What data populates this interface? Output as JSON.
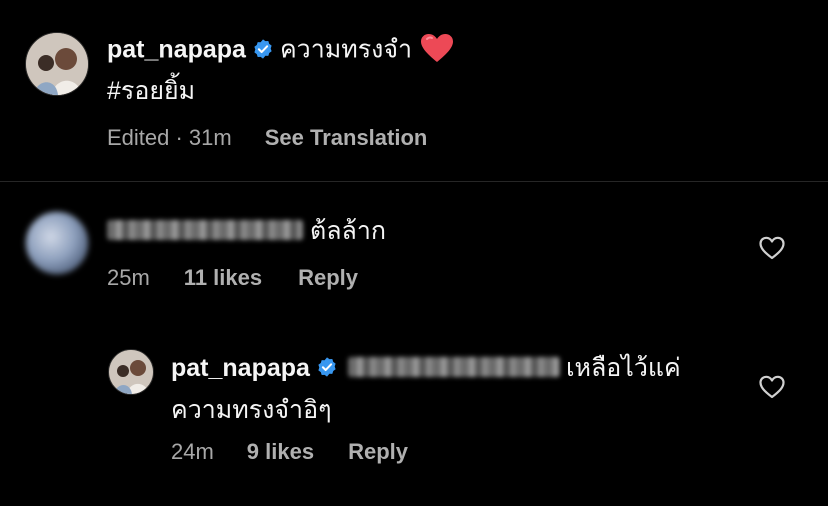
{
  "post": {
    "username": "pat_napapa",
    "caption_line1": "ความทรงจำ",
    "caption_line2": "#รอยยิ้ม",
    "edited": "Edited · 31m",
    "see_translation": "See Translation"
  },
  "comments": [
    {
      "text": "ต้ลล้าก",
      "time": "25m",
      "likes": "11 likes",
      "reply": "Reply"
    }
  ],
  "replies": [
    {
      "username": "pat_napapa",
      "text_line1": "เหลือไว้แค่",
      "text_line2": "ความทรงจำอิๆ",
      "time": "24m",
      "likes": "9 likes",
      "reply": "Reply"
    }
  ],
  "colors": {
    "background": "#000000",
    "text": "#f5f5f5",
    "meta": "#a8a8a8",
    "verified": "#3897f0",
    "heart_red": "#ed4956"
  },
  "icons": {
    "verified": "verified-badge-icon",
    "like": "heart-outline-icon",
    "emoji": "red-heart-emoji"
  }
}
